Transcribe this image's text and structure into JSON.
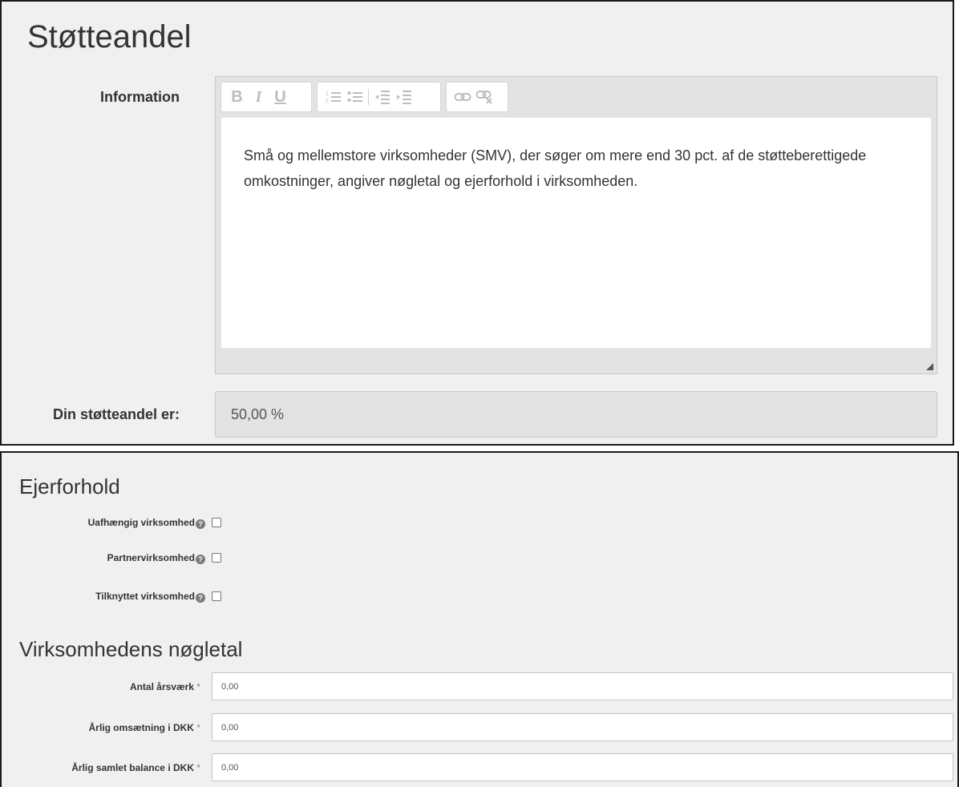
{
  "panel1": {
    "title": "Støtteandel",
    "information_label": "Information",
    "toolbar": {
      "bold": "B",
      "italic": "I",
      "underline": "U"
    },
    "editor_text": "Små og mellemstore virksomheder (SMV), der søger om mere end 30 pct. af de støtteberettigede omkostninger, angiver nøgletal og ejerforhold i virksomheden.",
    "rate_label": "Din støtteandel er:",
    "rate_value": "50,00 %"
  },
  "ejerforhold": {
    "title": "Ejerforhold",
    "help_glyph": "?",
    "options": [
      {
        "label": "Uafhængig virksomhed",
        "checked": false
      },
      {
        "label": "Partnervirksomhed",
        "checked": false
      },
      {
        "label": "Tilknyttet virksomhed",
        "checked": false
      }
    ]
  },
  "noegletal": {
    "title": "Virksomhedens nøgletal",
    "required_mark": "*",
    "fields": [
      {
        "label": "Antal årsværk",
        "value": "0,00"
      },
      {
        "label": "Årlig omsætning i DKK",
        "value": "0,00"
      },
      {
        "label": "Årlig samlet balance i DKK",
        "value": "0,00"
      }
    ]
  }
}
